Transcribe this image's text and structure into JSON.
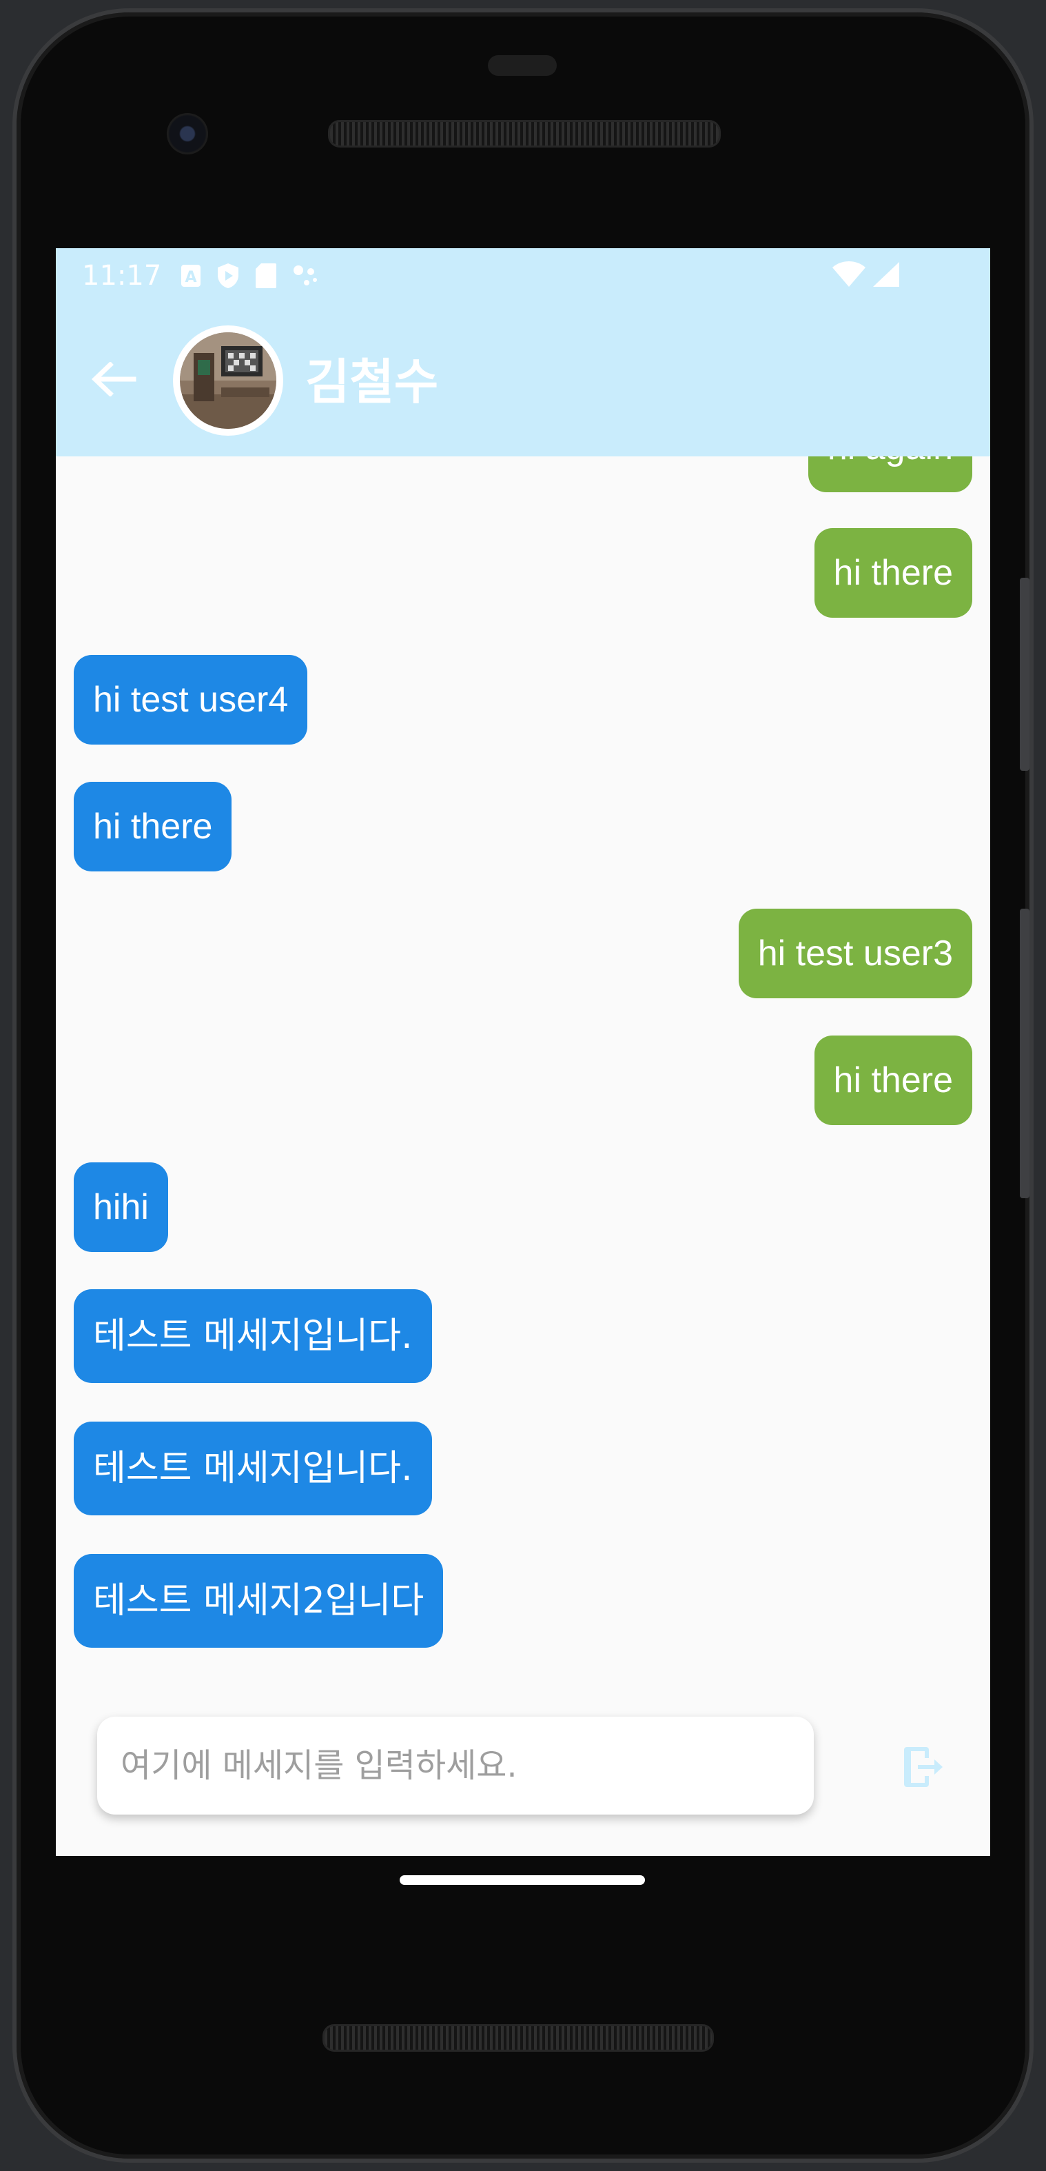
{
  "status_bar": {
    "time": "11:17"
  },
  "header": {
    "back_icon": "arrow-back-icon",
    "title": "김철수",
    "avatar_icon": "profile-photo",
    "background_color": "#c9ecfc"
  },
  "messages": [
    {
      "text": "hi again",
      "direction": "outgoing"
    },
    {
      "text": "hi there",
      "direction": "outgoing"
    },
    {
      "text": "hi test user4",
      "direction": "incoming"
    },
    {
      "text": "hi there",
      "direction": "incoming"
    },
    {
      "text": "hi test user3",
      "direction": "outgoing"
    },
    {
      "text": "hi there",
      "direction": "outgoing"
    },
    {
      "text": "hihi",
      "direction": "incoming"
    },
    {
      "text": "테스트 메세지입니다.",
      "direction": "incoming"
    },
    {
      "text": "테스트 메세지입니다.",
      "direction": "incoming"
    },
    {
      "text": "테스트 메세지2입니다",
      "direction": "incoming"
    }
  ],
  "colors": {
    "outgoing_bubble": "#7cb342",
    "incoming_bubble": "#1e88e5",
    "chat_background": "#fafafa"
  },
  "composer": {
    "placeholder": "여기에 메세지를 입력하세요.",
    "value": "",
    "send_icon": "send-exit-icon"
  }
}
